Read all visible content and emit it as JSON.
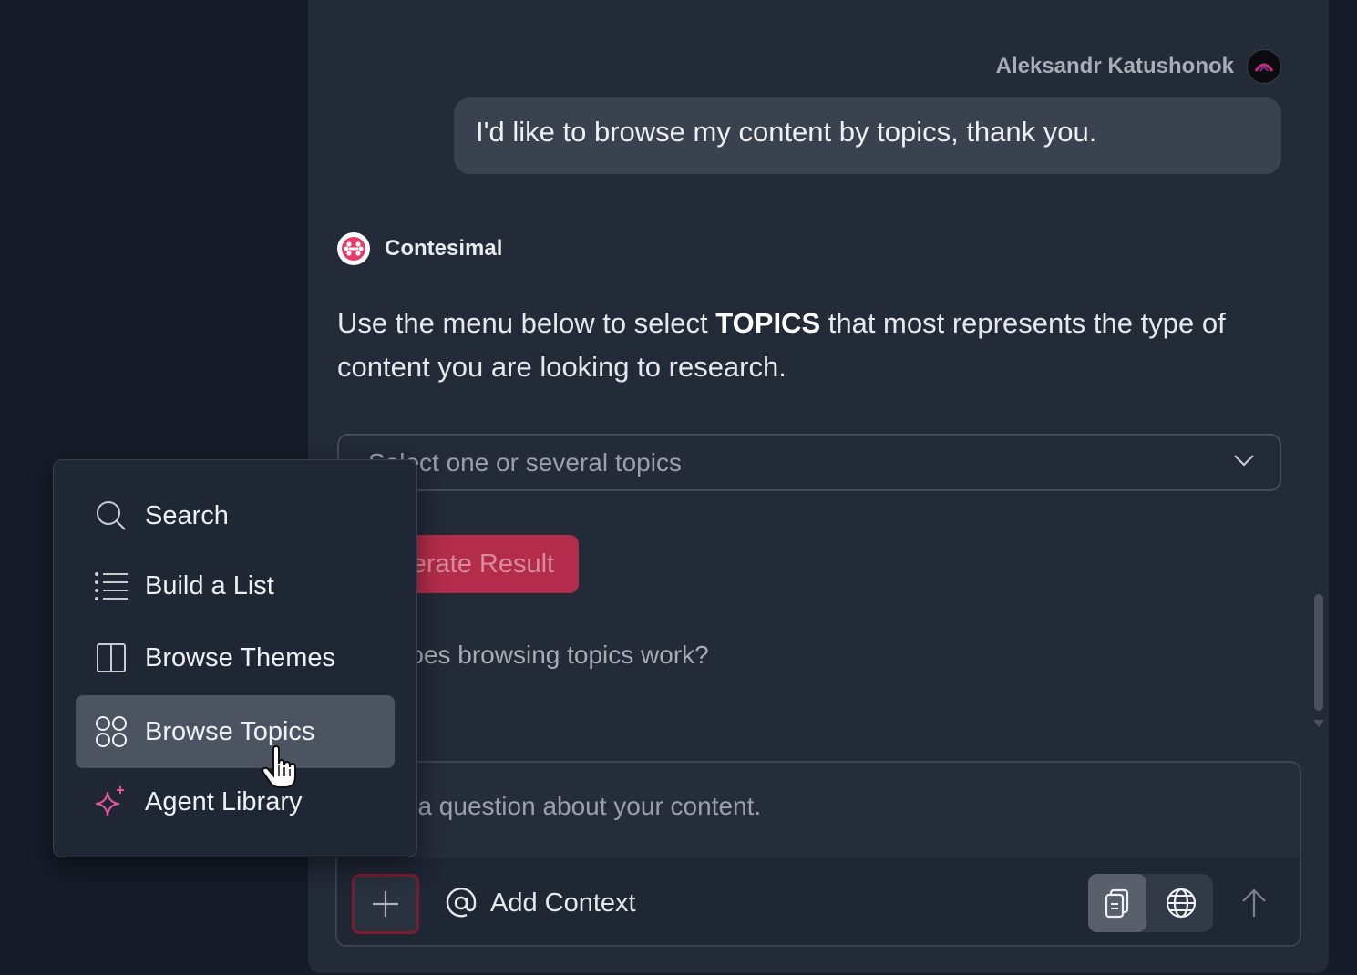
{
  "conversation": {
    "user": {
      "name": "Aleksandr Katushonok",
      "message": "I'd like to browse my content by topics, thank you."
    },
    "assistant": {
      "name": "Contesimal",
      "message_before": "Use the menu below to select ",
      "message_bold": "TOPICS",
      "message_after": " that most represents the type of content you are looking to research.",
      "select_placeholder": "Select one or several topics",
      "generate_label": "Generate Result",
      "faq_link": "How does browsing topics work?"
    }
  },
  "composer": {
    "placeholder": "Ask a question about your content.",
    "add_context_label": "Add Context"
  },
  "popup_menu": {
    "items": [
      {
        "label": "Search",
        "icon": "search-icon"
      },
      {
        "label": "Build a List",
        "icon": "list-icon"
      },
      {
        "label": "Browse Themes",
        "icon": "columns-icon"
      },
      {
        "label": "Browse Topics",
        "icon": "four-circles-icon",
        "active": true
      },
      {
        "label": "Agent Library",
        "icon": "sparkle-icon"
      }
    ]
  },
  "colors": {
    "accent": "#b32c4b",
    "agent_icon": "#e0569b",
    "panel": "#232a38",
    "background": "#151c28"
  }
}
